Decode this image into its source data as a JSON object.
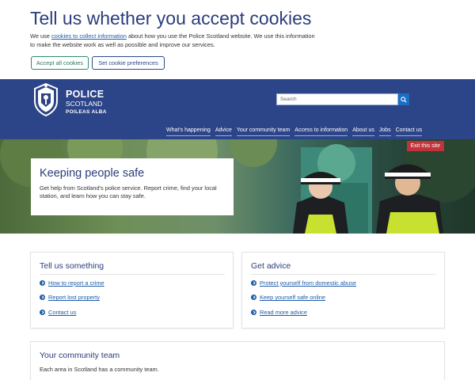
{
  "cookie": {
    "title": "Tell us whether you accept cookies",
    "text_before": "We use ",
    "link": "cookies to collect information",
    "text_after": " about how you use the Police Scotland website. We use this information to make the website work as well as possible and improve our services.",
    "accept_label": "Accept all cookies",
    "prefs_label": "Set cookie preferences"
  },
  "header": {
    "brand_line1": "POLICE",
    "brand_line2": "SCOTLAND",
    "brand_line3": "POILEAS ALBA",
    "search_placeholder": "Search",
    "nav": [
      "What's happening",
      "Advice",
      "Your community team",
      "Access to information",
      "About us",
      "Jobs",
      "Contact us"
    ]
  },
  "hero": {
    "exit_label": "Exit this site",
    "title": "Keeping people safe",
    "text": "Get help from Scotland's police service. Report crime, find your local station, and learn how you can stay safe."
  },
  "cards": {
    "tell": {
      "title": "Tell us something",
      "links": [
        "How to report a crime",
        "Report lost property",
        "Contact us"
      ]
    },
    "advice": {
      "title": "Get advice",
      "links": [
        "Protect yourself from domestic abuse",
        "Keep yourself safe online",
        "Read more advice"
      ]
    },
    "community": {
      "title": "Your community team",
      "text": "Each area in Scotland has a community team."
    }
  },
  "colors": {
    "brand_blue": "#2c4488",
    "title_blue": "#2a3d7c",
    "link_blue": "#1c5ca8",
    "exit_red": "#c0333a",
    "accept_green": "#2d8a6e"
  }
}
